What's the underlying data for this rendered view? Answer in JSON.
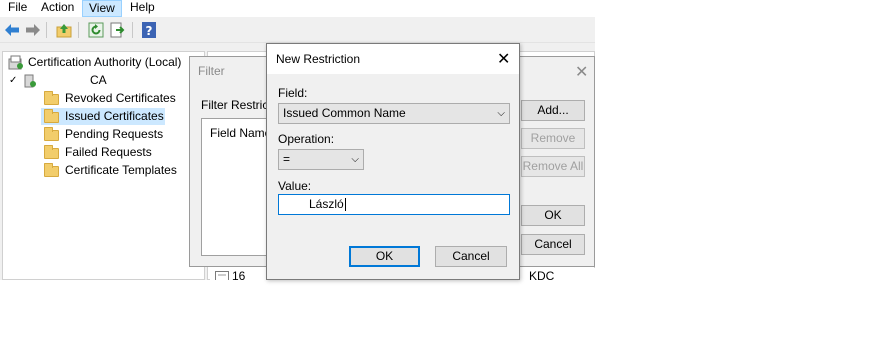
{
  "menu": [
    "File",
    "Action",
    "View",
    "Help"
  ],
  "active_menu_index": 2,
  "tree": {
    "root": "Certification Authority (Local)",
    "ca_name": "CA",
    "items": [
      "Revoked Certificates",
      "Issued Certificates",
      "Pending Requests",
      "Failed Requests",
      "Certificate Templates"
    ],
    "selected_index": 1
  },
  "filter_dialog": {
    "title": "Filter",
    "label": "Filter Restrictio",
    "column_header": "Field Name",
    "buttons": {
      "add": "Add...",
      "remove": "Remove",
      "remove_all": "Remove All",
      "ok": "OK",
      "cancel": "Cancel"
    }
  },
  "result_row": {
    "id": "16",
    "template": "KDC Authen"
  },
  "new_restriction": {
    "title": "New Restriction",
    "field_label": "Field:",
    "field_value": "Issued Common Name",
    "operation_label": "Operation:",
    "operation_value": "=",
    "value_label": "Value:",
    "value_text": "László",
    "ok": "OK",
    "cancel": "Cancel"
  },
  "colors": {
    "accent": "#0078d7",
    "selection": "#cce8ff",
    "folder": "#f2cd6b"
  },
  "icons": [
    "back-arrow-icon",
    "forward-arrow-icon",
    "up-folder-icon",
    "refresh-icon",
    "export-icon",
    "help-icon",
    "folder-icon",
    "close-icon",
    "chevron-down-icon"
  ]
}
